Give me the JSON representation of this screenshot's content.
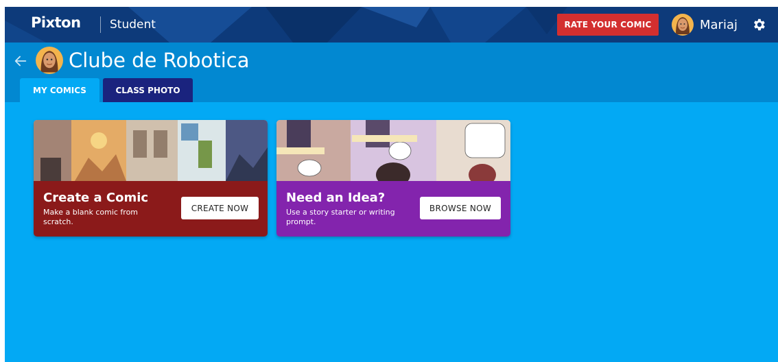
{
  "nav": {
    "logo": "Pixton",
    "section": "Student",
    "rate_button": "RATE YOUR COMIC",
    "user_name": "Mariaj",
    "settings_icon": "gear-icon"
  },
  "header": {
    "class_title": "Clube de Robotica",
    "back_icon": "arrow-left-icon",
    "tabs": [
      {
        "label": "MY COMICS",
        "active": true
      },
      {
        "label": "CLASS PHOTO",
        "active": false
      }
    ]
  },
  "cards": [
    {
      "title": "Create a Comic",
      "description": "Make a blank comic from scratch.",
      "button": "CREATE NOW",
      "color": "#8b1a1a"
    },
    {
      "title": "Need an Idea?",
      "description": "Use a story starter or writing prompt.",
      "button": "BROWSE NOW",
      "color": "#8324ad"
    }
  ],
  "colors": {
    "page_bg": "#03a9f4",
    "nav_bg": "#0d3a7a",
    "header_bg": "#0288d1",
    "rate_button": "#d32f2f",
    "active_tab": "#03a9f4",
    "inactive_tab": "#1a237e"
  }
}
